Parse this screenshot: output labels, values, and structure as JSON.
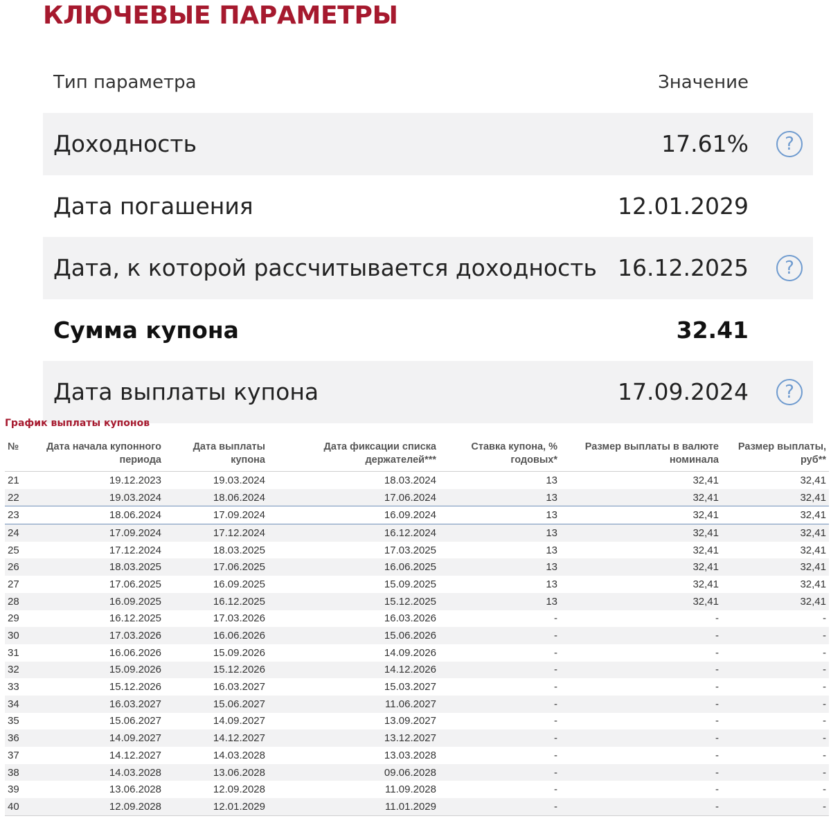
{
  "params_section": {
    "title": "КЛЮЧЕВЫЕ ПАРАМЕТРЫ",
    "header": {
      "type": "Тип параметра",
      "value": "Значение"
    },
    "rows": [
      {
        "label": "Доходность",
        "value": "17.61%",
        "help": "?"
      },
      {
        "label": "Дата погашения",
        "value": "12.01.2029"
      },
      {
        "label": "Дата, к которой рассчитывается доходность",
        "value": "16.12.2025",
        "help": "?"
      },
      {
        "label": "Сумма купона",
        "value": "32.41"
      },
      {
        "label": "Дата выплаты купона",
        "value": "17.09.2024",
        "help": "?"
      }
    ]
  },
  "schedule": {
    "title": "График выплаты купонов",
    "headers": [
      "№",
      "Дата начала купонного периода",
      "Дата выплаты купона",
      "Дата фиксации списка держателей***",
      "Ставка купона, % годовых*",
      "Размер выплаты в валюте номинала",
      "Размер выплаты, руб**"
    ],
    "rows": [
      [
        "21",
        "19.12.2023",
        "19.03.2024",
        "18.03.2024",
        "13",
        "32,41",
        "32,41"
      ],
      [
        "22",
        "19.03.2024",
        "18.06.2024",
        "17.06.2024",
        "13",
        "32,41",
        "32,41"
      ],
      [
        "23",
        "18.06.2024",
        "17.09.2024",
        "16.09.2024",
        "13",
        "32,41",
        "32,41"
      ],
      [
        "24",
        "17.09.2024",
        "17.12.2024",
        "16.12.2024",
        "13",
        "32,41",
        "32,41"
      ],
      [
        "25",
        "17.12.2024",
        "18.03.2025",
        "17.03.2025",
        "13",
        "32,41",
        "32,41"
      ],
      [
        "26",
        "18.03.2025",
        "17.06.2025",
        "16.06.2025",
        "13",
        "32,41",
        "32,41"
      ],
      [
        "27",
        "17.06.2025",
        "16.09.2025",
        "15.09.2025",
        "13",
        "32,41",
        "32,41"
      ],
      [
        "28",
        "16.09.2025",
        "16.12.2025",
        "15.12.2025",
        "13",
        "32,41",
        "32,41"
      ],
      [
        "29",
        "16.12.2025",
        "17.03.2026",
        "16.03.2026",
        "-",
        "-",
        "-"
      ],
      [
        "30",
        "17.03.2026",
        "16.06.2026",
        "15.06.2026",
        "-",
        "-",
        "-"
      ],
      [
        "31",
        "16.06.2026",
        "15.09.2026",
        "14.09.2026",
        "-",
        "-",
        "-"
      ],
      [
        "32",
        "15.09.2026",
        "15.12.2026",
        "14.12.2026",
        "-",
        "-",
        "-"
      ],
      [
        "33",
        "15.12.2026",
        "16.03.2027",
        "15.03.2027",
        "-",
        "-",
        "-"
      ],
      [
        "34",
        "16.03.2027",
        "15.06.2027",
        "11.06.2027",
        "-",
        "-",
        "-"
      ],
      [
        "35",
        "15.06.2027",
        "14.09.2027",
        "13.09.2027",
        "-",
        "-",
        "-"
      ],
      [
        "36",
        "14.09.2027",
        "14.12.2027",
        "13.12.2027",
        "-",
        "-",
        "-"
      ],
      [
        "37",
        "14.12.2027",
        "14.03.2028",
        "13.03.2028",
        "-",
        "-",
        "-"
      ],
      [
        "38",
        "14.03.2028",
        "13.06.2028",
        "09.06.2028",
        "-",
        "-",
        "-"
      ],
      [
        "39",
        "13.06.2028",
        "12.09.2028",
        "11.09.2028",
        "-",
        "-",
        "-"
      ],
      [
        "40",
        "12.09.2028",
        "12.01.2029",
        "11.01.2029",
        "-",
        "-",
        "-"
      ]
    ],
    "current_row_index": 2
  },
  "colors": {
    "accent": "#a6192e",
    "row_shade": "#f2f2f3",
    "help_icon": "#6f9bcf",
    "current_row_line": "#6f8fb8"
  }
}
